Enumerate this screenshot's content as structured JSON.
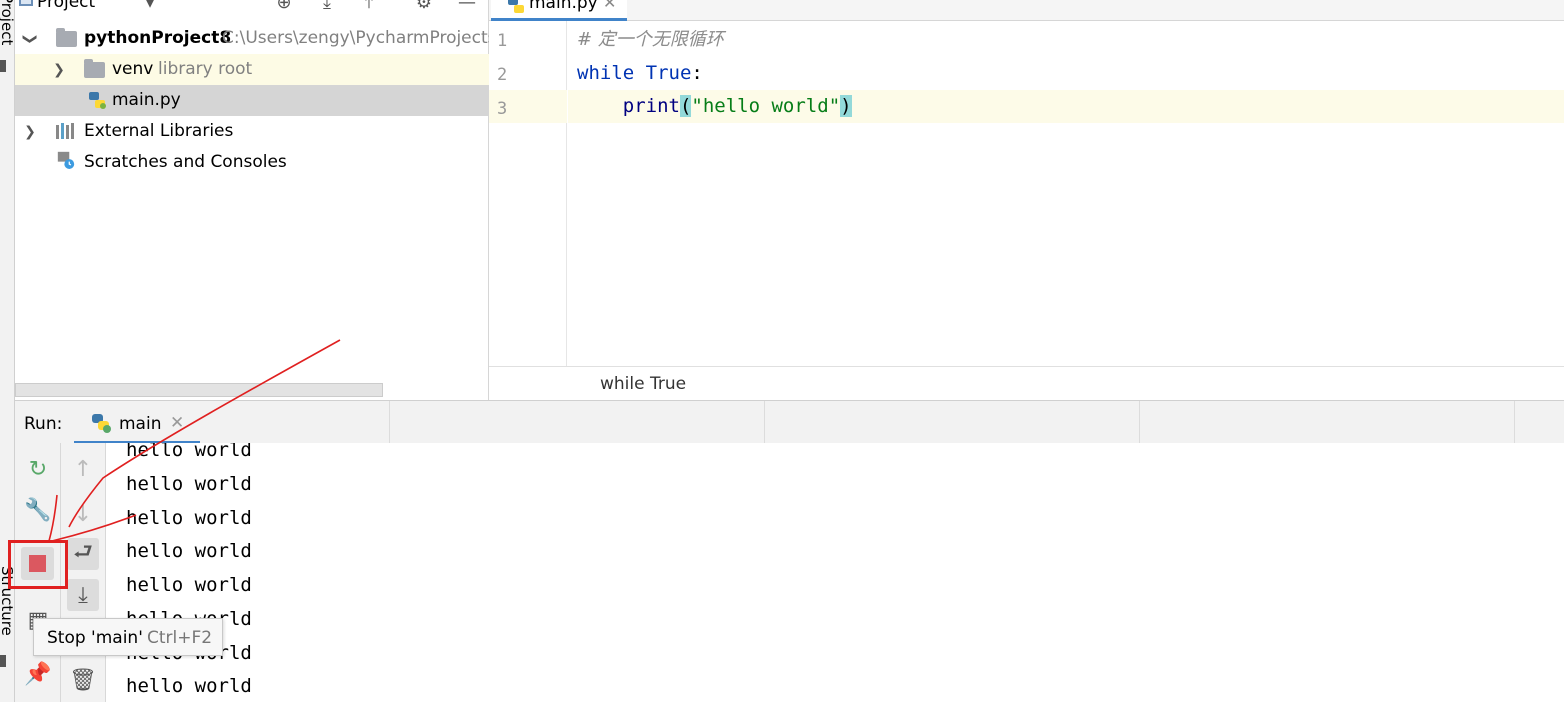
{
  "sidebar": {
    "project_tab": "Project",
    "structure_tab": "Structure"
  },
  "project_pane": {
    "title": "Project",
    "header_icons": [
      "locate-icon",
      "collapse-all-icon",
      "expand-icon",
      "gear-icon",
      "minimize-icon"
    ],
    "tree": {
      "root_name": "pythonProject8",
      "root_path": "C:\\Users\\zengy\\PycharmProjects\\",
      "venv_name": "venv",
      "venv_note": "library root",
      "main_file": "main.py",
      "external_libraries": "External Libraries",
      "scratches": "Scratches and Consoles"
    }
  },
  "editor": {
    "tab_name": "main.py",
    "line_numbers": [
      "1",
      "2",
      "3"
    ],
    "code": {
      "line1_comment": "# 定一个无限循环",
      "line2_kw": "while",
      "line2_true": "True",
      "line2_colon": ":",
      "line3_indent": "    ",
      "line3_fn": "print",
      "line3_open": "(",
      "line3_str": "\"hello world\"",
      "line3_close": ")"
    },
    "breadcrumb": "while True"
  },
  "run_panel": {
    "label": "Run:",
    "tab_name": "main",
    "output_lines": [
      "hello world",
      "hello world",
      "hello world",
      "hello world",
      "hello world",
      "hello world",
      "hello world",
      "hello world"
    ],
    "tooltip_action": "Stop 'main'",
    "tooltip_shortcut": "Ctrl+F2"
  },
  "colors": {
    "keyword": "#0033b3",
    "string": "#067d17",
    "stop_red": "#db5860",
    "annotation_red": "#e02020",
    "accent_blue": "#4083c9"
  }
}
